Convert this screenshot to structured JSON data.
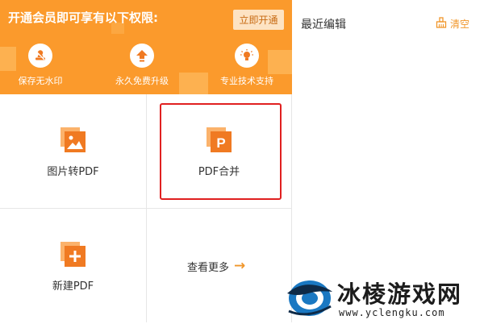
{
  "banner": {
    "title": "开通会员即可享有以下权限:",
    "vip_button_label": "立即开通",
    "benefits": [
      {
        "icon": "stamp-icon",
        "label": "保存无水印"
      },
      {
        "icon": "upgrade-arrow-icon",
        "label": "永久免费升级"
      },
      {
        "icon": "lightbulb-icon",
        "label": "专业技术支持"
      }
    ]
  },
  "tools": [
    {
      "icon": "image-icon",
      "label": "图片转PDF"
    },
    {
      "icon": "pdf-merge-icon",
      "label": "PDF合并",
      "selected": true
    },
    {
      "icon": "add-document-icon",
      "label": "新建PDF"
    },
    {
      "label": "查看更多",
      "arrow": "→"
    }
  ],
  "recent": {
    "title": "最近编辑",
    "clear_label": "清空"
  },
  "watermark": {
    "text": "冰棱游戏网",
    "url": "www.yclengku.com"
  },
  "colors": {
    "brand_orange": "#fb9a2c",
    "icon_orange": "#f07a22",
    "highlight_red": "#e02020",
    "link_orange": "#f0962a"
  }
}
